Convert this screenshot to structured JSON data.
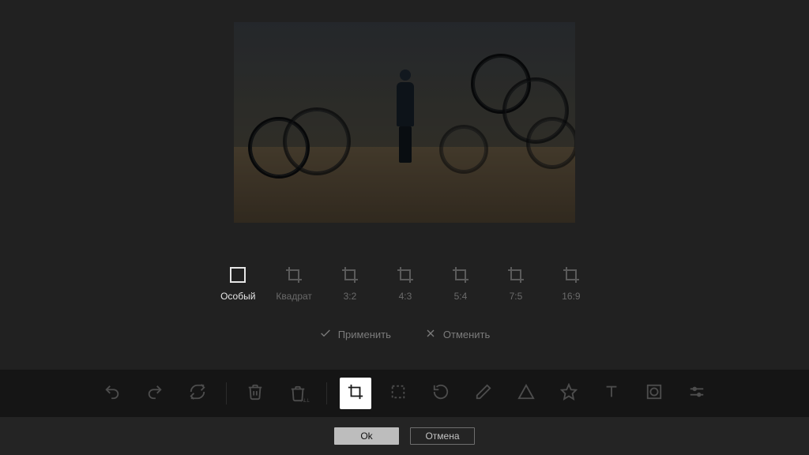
{
  "ratios": {
    "items": [
      {
        "label": "Особый",
        "name": "aspect-custom",
        "active": true
      },
      {
        "label": "Квадрат",
        "name": "aspect-square",
        "active": false
      },
      {
        "label": "3:2",
        "name": "aspect-3-2",
        "active": false
      },
      {
        "label": "4:3",
        "name": "aspect-4-3",
        "active": false
      },
      {
        "label": "5:4",
        "name": "aspect-5-4",
        "active": false
      },
      {
        "label": "7:5",
        "name": "aspect-7-5",
        "active": false
      },
      {
        "label": "16:9",
        "name": "aspect-16-9",
        "active": false
      }
    ]
  },
  "actions": {
    "apply": "Применить",
    "cancel": "Отменить"
  },
  "footer": {
    "ok": "Ok",
    "cancel": "Отмена"
  }
}
